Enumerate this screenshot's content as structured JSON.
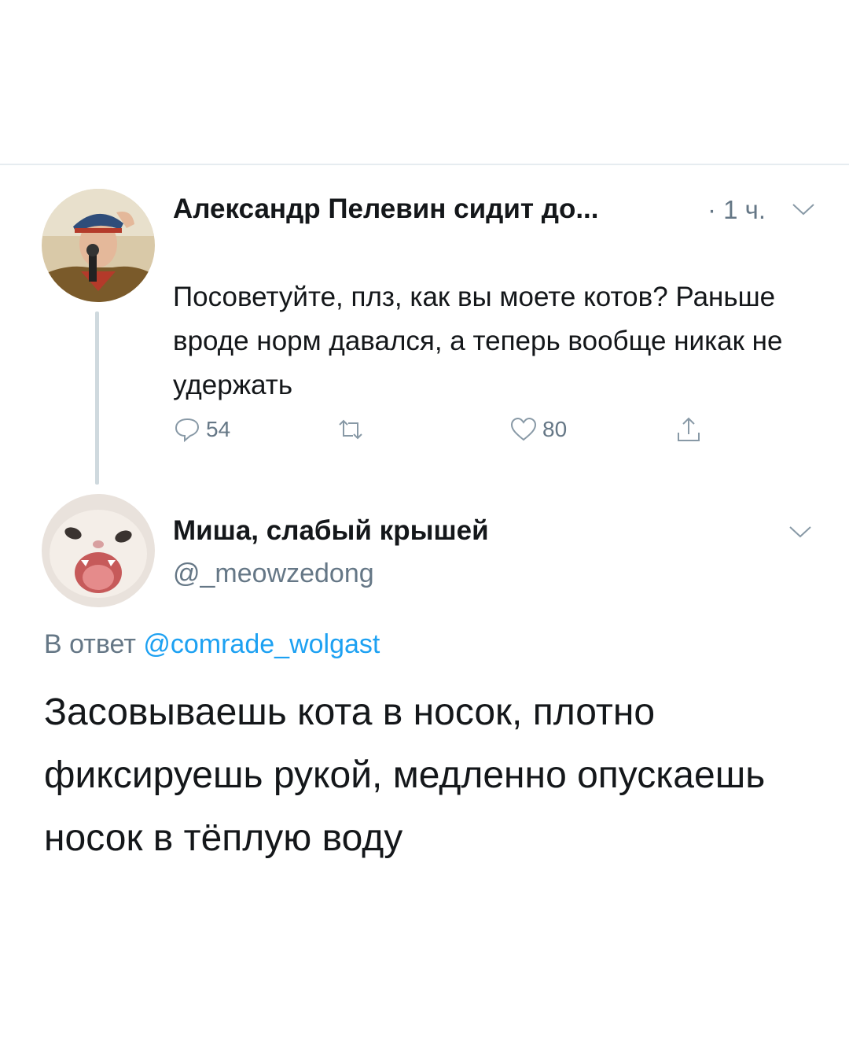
{
  "tweet1": {
    "author_name": "Александр Пелевин сидит до...",
    "time": "· 1 ч.",
    "text": "Посоветуйте, плз, как вы моете котов? Раньше вроде норм давался, а теперь вообще никак не удержать",
    "reply_count": "54",
    "like_count": "80",
    "icons": [
      "reply-icon",
      "retweet-icon",
      "like-icon",
      "share-icon",
      "chevron-down-icon"
    ]
  },
  "tweet2": {
    "author_name": "Миша, слабый крышей",
    "handle": "@_meowzedong",
    "reply_prefix": "В ответ",
    "reply_mention": "@comrade_wolgast",
    "text": "Засовываешь кота в носок, плотно фиксируешь рукой, медленно опускаешь носок в тёплую воду"
  },
  "colors": {
    "text_primary": "#14171a",
    "text_secondary": "#657786",
    "link": "#1da1f2",
    "divider": "#e6ecf0",
    "thread_line": "#cfd9de"
  }
}
